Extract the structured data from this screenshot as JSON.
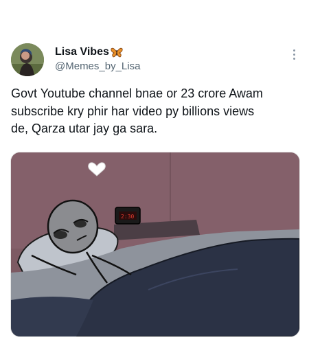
{
  "author": {
    "display_name": "Lisa Vibes",
    "handle": "@Memes_by_Lisa",
    "badge_icon": "butterfly-emoji"
  },
  "tweet": {
    "text": "Govt Youtube channel bnae or 23 crore Awam\nsubscribe kry phir har video py billions views\nde, Qarza utar jay ga sara."
  },
  "media": {
    "description_icon": "meme-image",
    "clock_icon": "alarm-clock",
    "thought_icon": "heart-cloud"
  },
  "colors": {
    "handle": "#536471",
    "wall": "#7d5a63",
    "blanket": "#2b3245",
    "headboard": "#4a3f46"
  }
}
